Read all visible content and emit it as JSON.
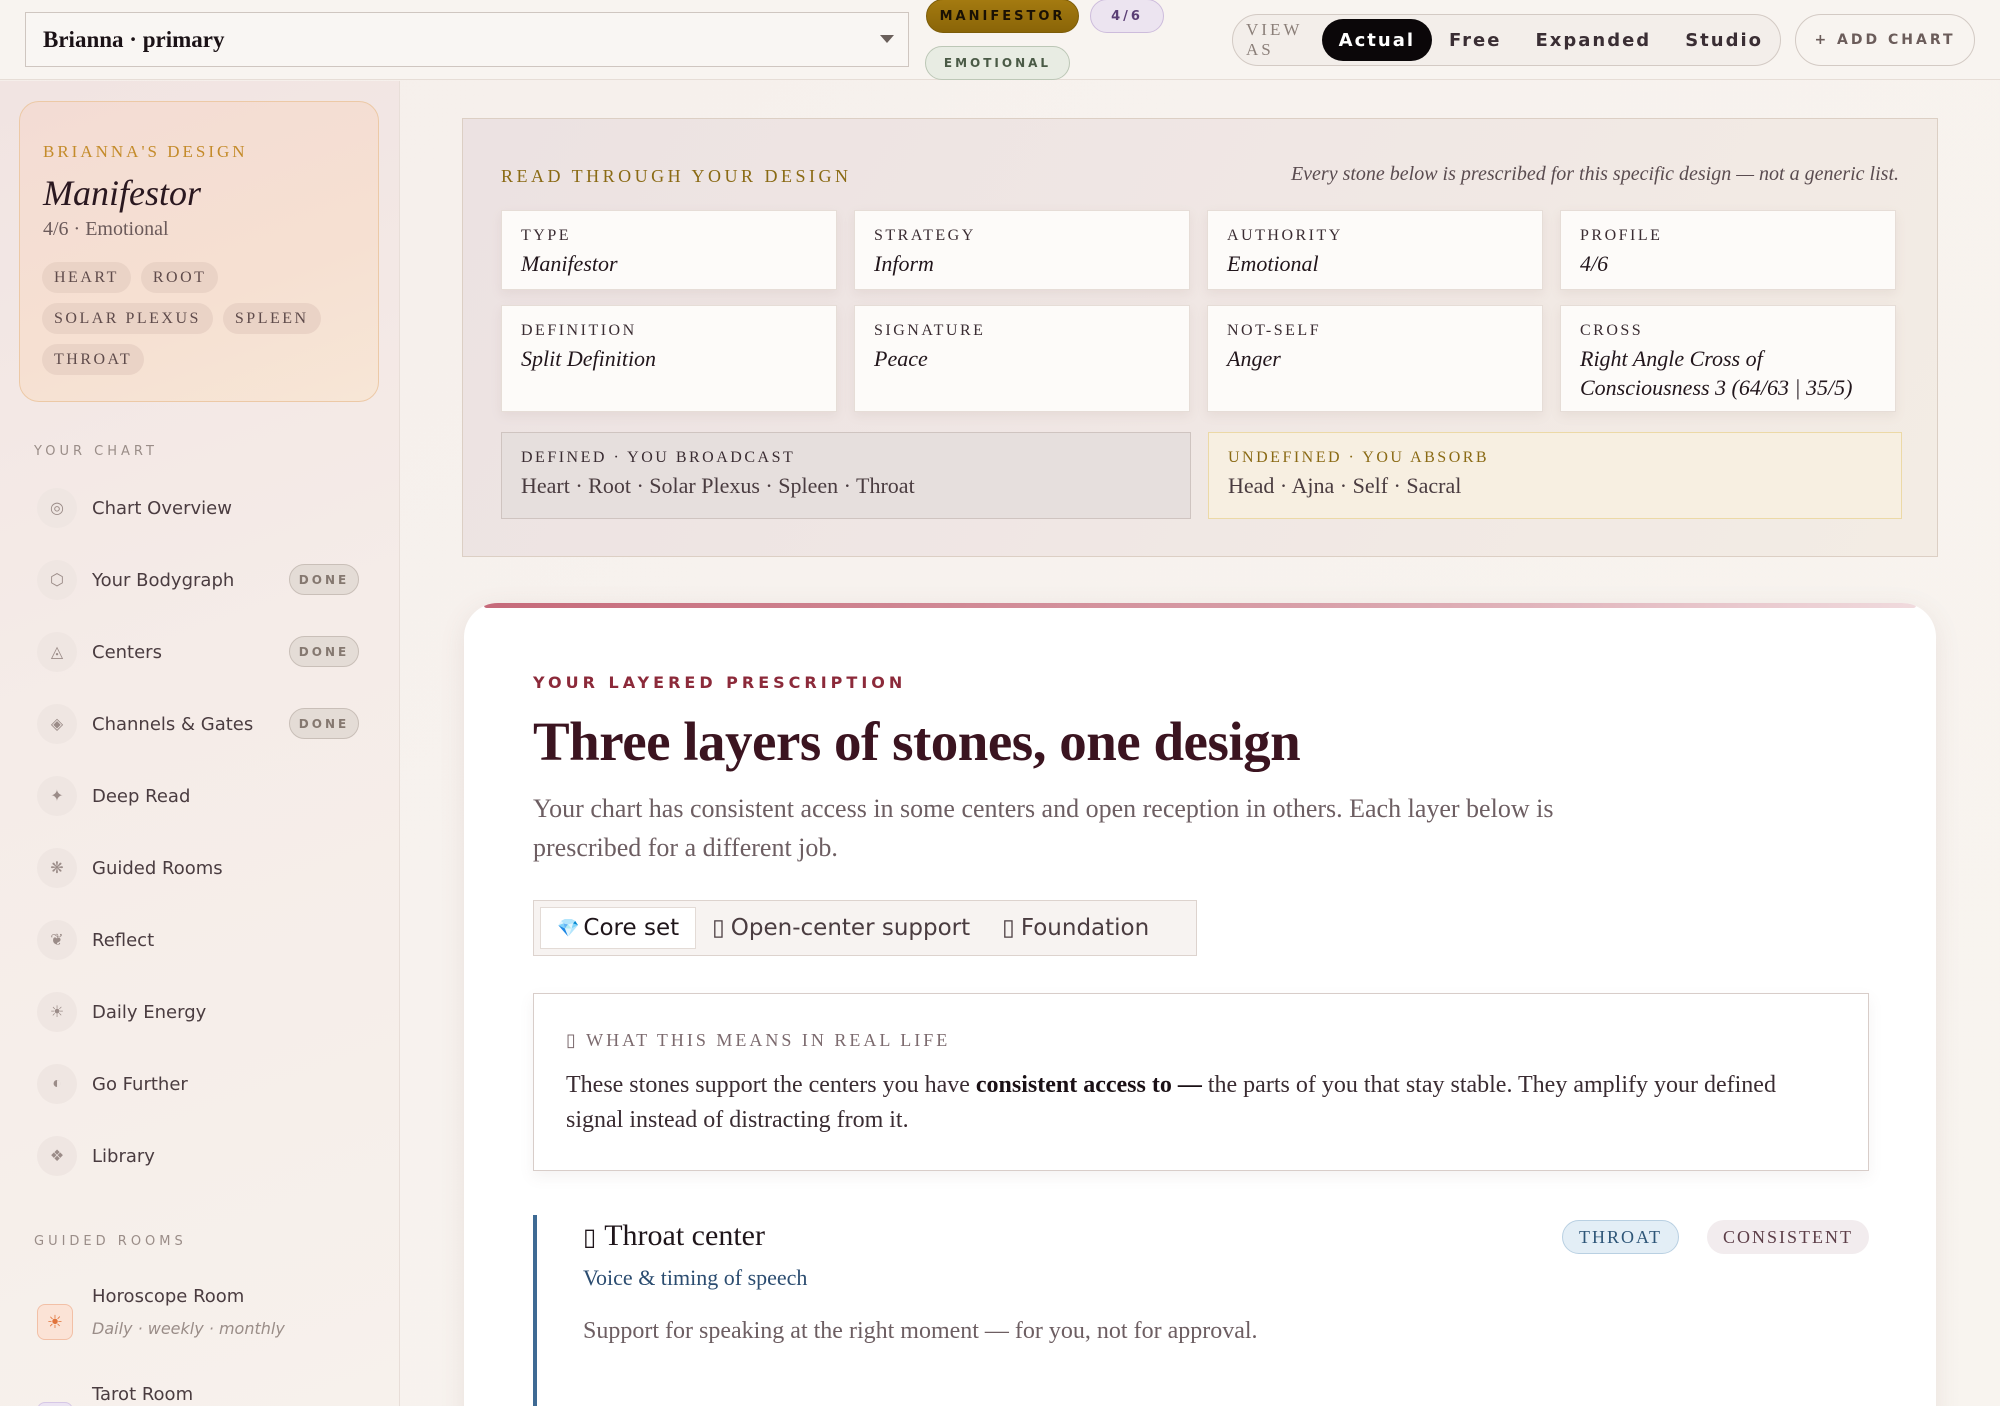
{
  "topbar": {
    "chart_select": "Brianna · primary",
    "type_pill": "MANIFESTOR",
    "profile_pill": "4/6",
    "authority_pill": "EMOTIONAL",
    "view_as_label": "VIEW AS",
    "view_options": [
      "Actual",
      "Free",
      "Expanded",
      "Studio"
    ],
    "view_selected": "Actual",
    "add_chart": "+ ADD CHART"
  },
  "sidebar": {
    "design_card": {
      "eyebrow": "BRIANNA'S DESIGN",
      "type": "Manifestor",
      "sub": "4/6 · Emotional",
      "centers": [
        "HEART",
        "ROOT",
        "SOLAR PLEXUS",
        "SPLEEN",
        "THROAT"
      ]
    },
    "your_chart_heading": "YOUR CHART",
    "items": [
      {
        "label": "Chart Overview",
        "icon": "◎",
        "done": ""
      },
      {
        "label": "Your Bodygraph",
        "icon": "⬡",
        "done": "DONE"
      },
      {
        "label": "Centers",
        "icon": "◬",
        "done": "DONE"
      },
      {
        "label": "Channels & Gates",
        "icon": "◈",
        "done": "DONE"
      },
      {
        "label": "Deep Read",
        "icon": "✦",
        "done": ""
      },
      {
        "label": "Guided Rooms",
        "icon": "❋",
        "done": ""
      },
      {
        "label": "Reflect",
        "icon": "❦",
        "done": ""
      },
      {
        "label": "Daily Energy",
        "icon": "☀",
        "done": ""
      },
      {
        "label": "Go Further",
        "icon": "◐",
        "done": ""
      },
      {
        "label": "Library",
        "icon": "❖",
        "done": ""
      }
    ],
    "guided_rooms_heading": "GUIDED ROOMS",
    "rooms": [
      {
        "title": "Horoscope Room",
        "sub": "Daily · weekly · monthly",
        "icon": "☀"
      },
      {
        "title": "Tarot Room",
        "sub": "",
        "icon": "✧"
      }
    ]
  },
  "read_panel": {
    "eyebrow": "READ THROUGH YOUR DESIGN",
    "note": "Every stone below is prescribed for this specific design — not a generic list.",
    "facts": [
      {
        "k": "TYPE",
        "v": "Manifestor"
      },
      {
        "k": "STRATEGY",
        "v": "Inform"
      },
      {
        "k": "AUTHORITY",
        "v": "Emotional"
      },
      {
        "k": "PROFILE",
        "v": "4/6"
      },
      {
        "k": "DEFINITION",
        "v": "Split Definition"
      },
      {
        "k": "SIGNATURE",
        "v": "Peace"
      },
      {
        "k": "NOT-SELF",
        "v": "Anger"
      },
      {
        "k": "CROSS",
        "v": "Right Angle Cross of Consciousness 3 (64/63 | 35/5)"
      }
    ],
    "defined": {
      "k": "DEFINED · YOU BROADCAST",
      "v": "Heart · Root · Solar Plexus · Spleen · Throat"
    },
    "undefined": {
      "k": "UNDEFINED · YOU ABSORB",
      "v": "Head · Ajna · Self · Sacral"
    }
  },
  "prescription": {
    "eyebrow": "YOUR LAYERED PRESCRIPTION",
    "title": "Three layers of stones, one design",
    "lead": "Your chart has consistent access in some centers and open reception in others. Each layer below is prescribed for a different job.",
    "tabs": [
      {
        "icon": "💎",
        "label": "Core set"
      },
      {
        "icon": "▯",
        "label": "Open-center support"
      },
      {
        "icon": "▯",
        "label": "Foundation"
      }
    ],
    "real_life": {
      "k": "▯ WHAT THIS MEANS IN REAL LIFE",
      "v_pre": "These stones support the centers you have ",
      "v_bold": "consistent access to —",
      "v_post": " the parts of you that stay stable. They amplify your defined signal instead of distracting from it."
    },
    "center_card": {
      "icon": "▯",
      "title": "Throat center",
      "sub": "Voice & timing of speech",
      "body": "Support for speaking at the right moment — for you, not for approval.",
      "tags": [
        "THROAT",
        "CONSISTENT"
      ]
    }
  }
}
